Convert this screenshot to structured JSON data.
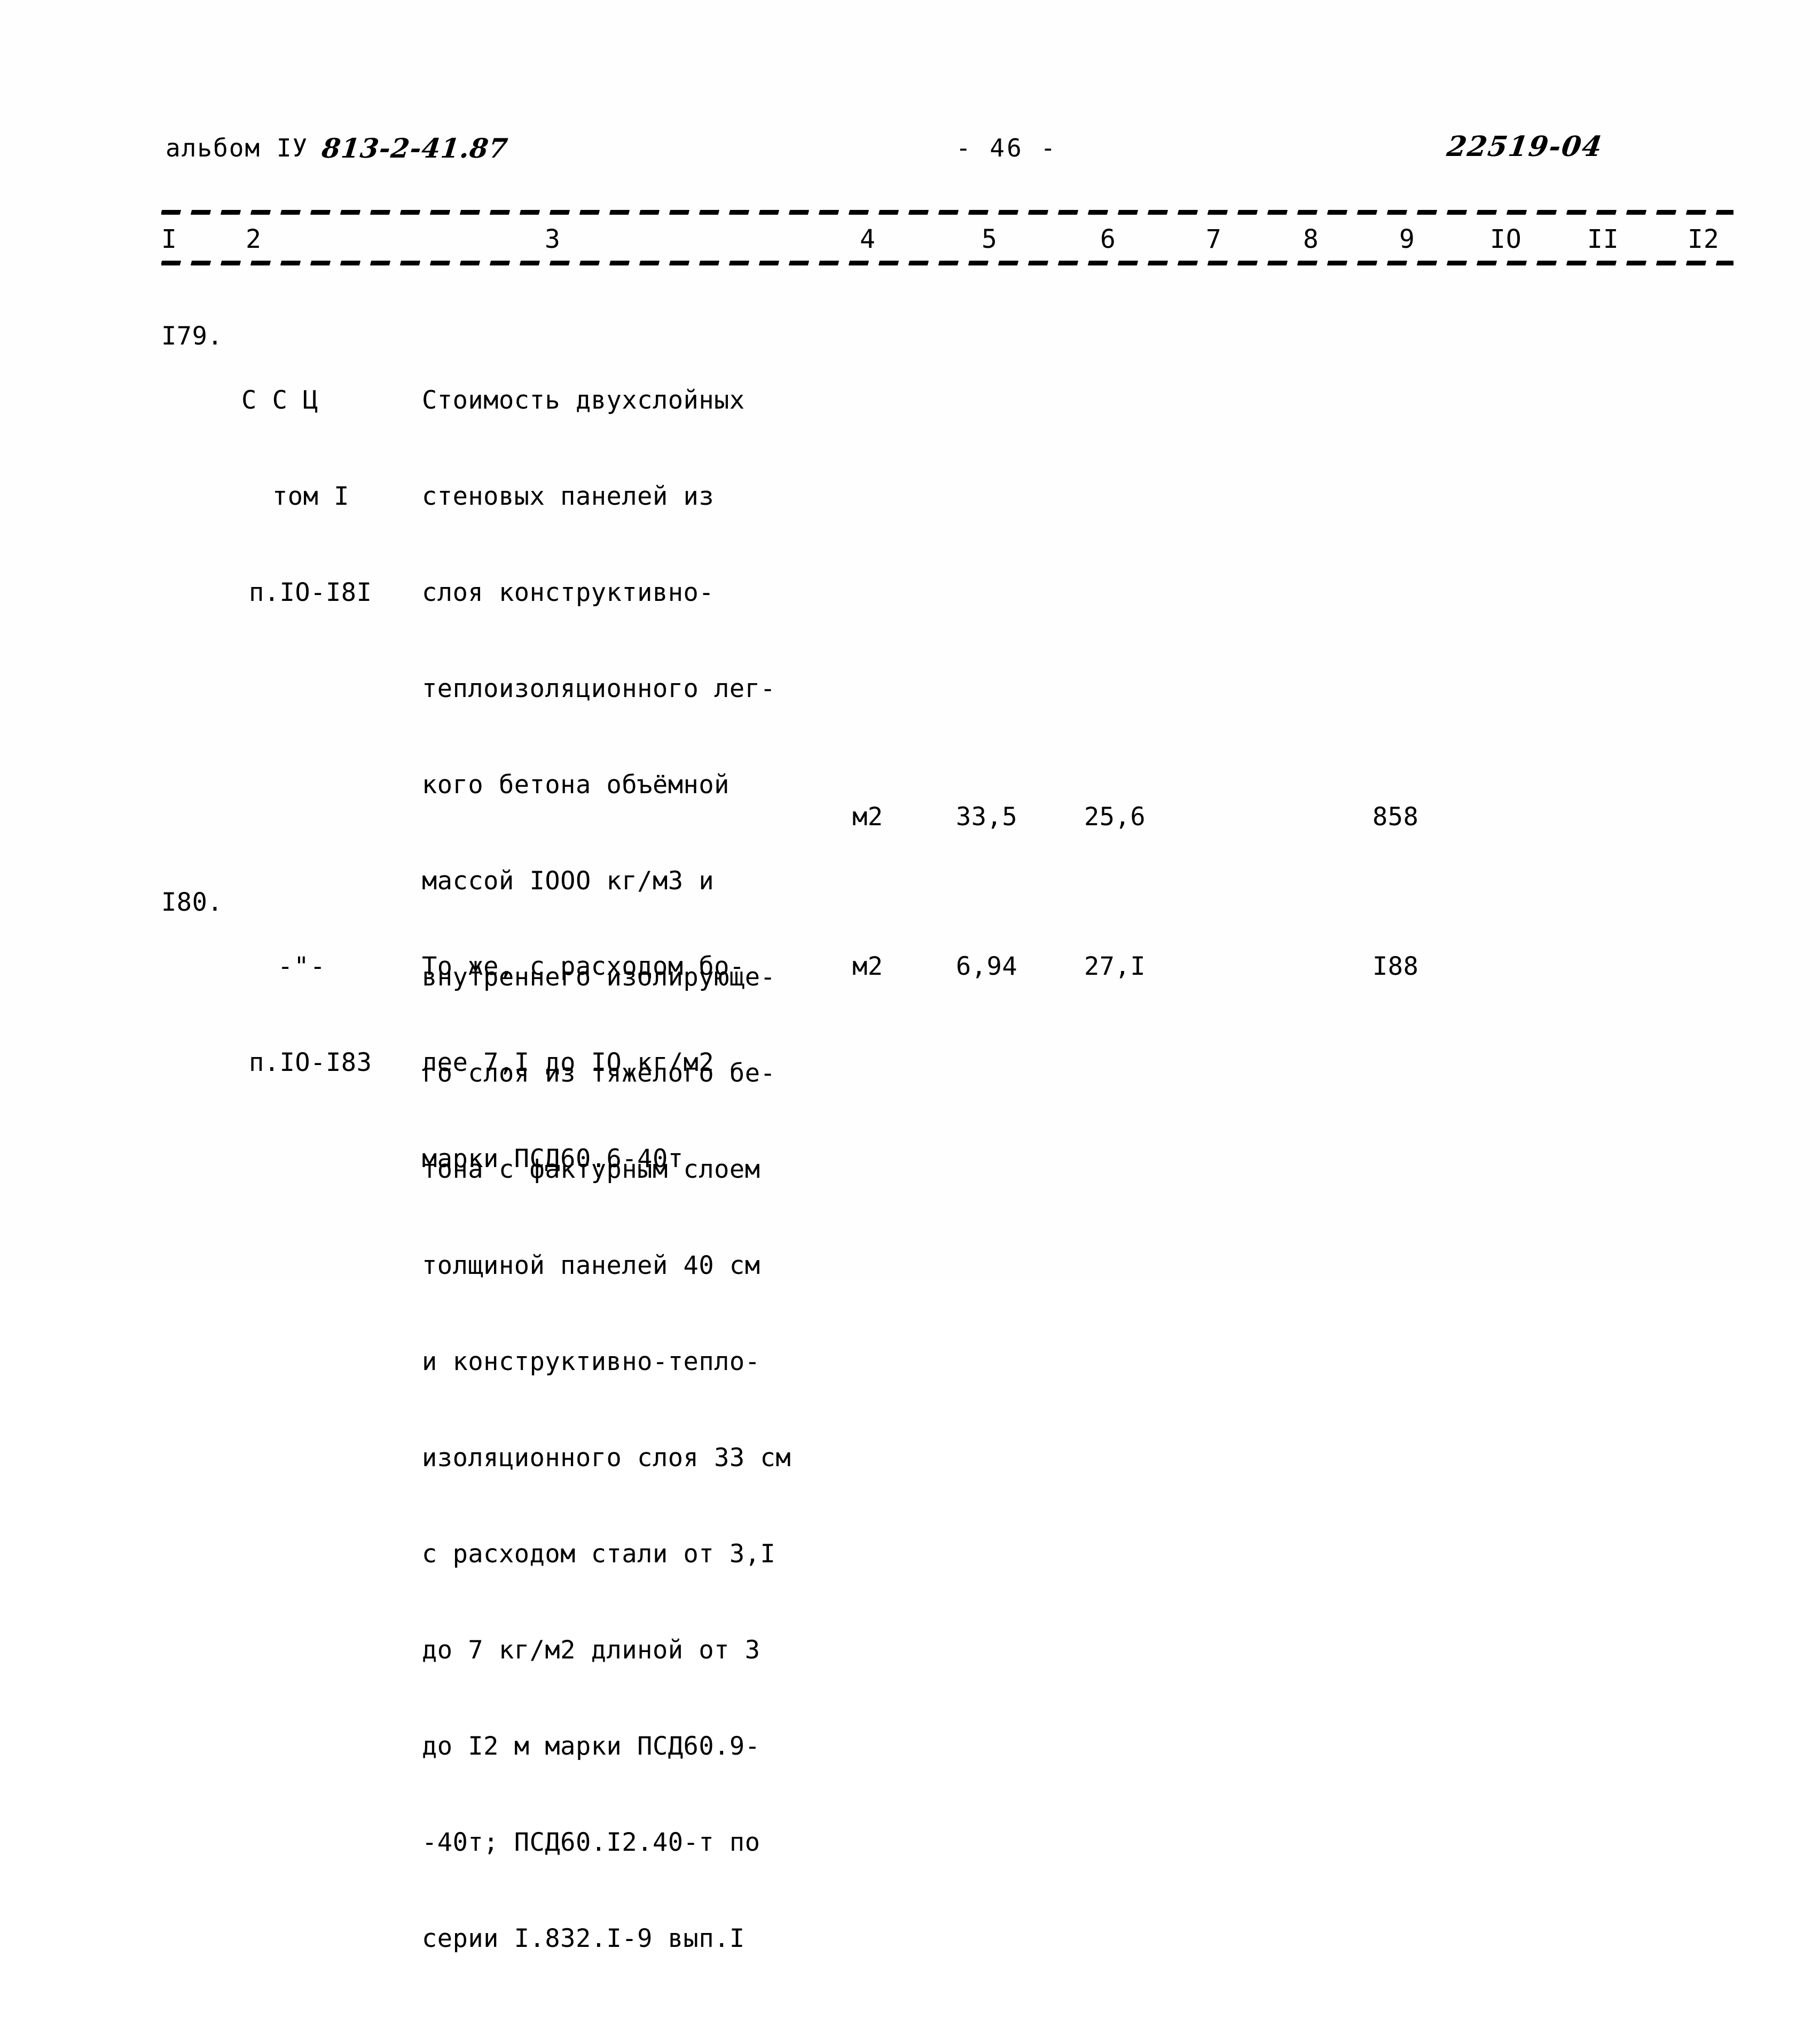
{
  "header": {
    "album_label": "альбом IУ",
    "album_code": "813-2-41.87",
    "page_number": "- 46 -",
    "archive_code": "22519-04"
  },
  "table": {
    "column_numbers": [
      "I",
      "2",
      "3",
      "4",
      "5",
      "6",
      "7",
      "8",
      "9",
      "IO",
      "II",
      "I2"
    ],
    "rows": [
      {
        "number": "I79.",
        "justification": {
          "line1": "С С Ц",
          "line2": "том I",
          "line3": "п.IO-I8I"
        },
        "description_lines": [
          "Стоимость двухслойных",
          "стеновых панелей из",
          "слоя конструктивно-",
          "теплоизоляционного лег-",
          "кого бетона объёмной",
          "массой IООО кг/м3 и",
          "внутреннего изолирующе-",
          "го слоя из тяжелого бе-",
          "тона с фактурным слоем",
          "толщиной панелей 40 см",
          "и конструктивно-тепло-",
          "изоляционного слоя 33 см",
          "с расходом стали от 3,I",
          "до 7 кг/м2 длиной от 3",
          "до I2 м марки ПСД60.9-",
          "-40т; ПСД60.I2.40-т по",
          "серии I.832.I-9 вып.I"
        ],
        "unit": "м2",
        "col5": "33,5",
        "col6": "25,6",
        "col9": "858"
      },
      {
        "number": "I80.",
        "justification": {
          "line1": "-\"-",
          "line2": "п.IO-I83"
        },
        "description_lines": [
          "То же, с расходом бо-",
          "лее 7,I до IO кг/м2",
          "марки ПСД60.6-40т"
        ],
        "unit": "м2",
        "col5": "6,94",
        "col6": "27,I",
        "col9": "I88"
      }
    ]
  }
}
